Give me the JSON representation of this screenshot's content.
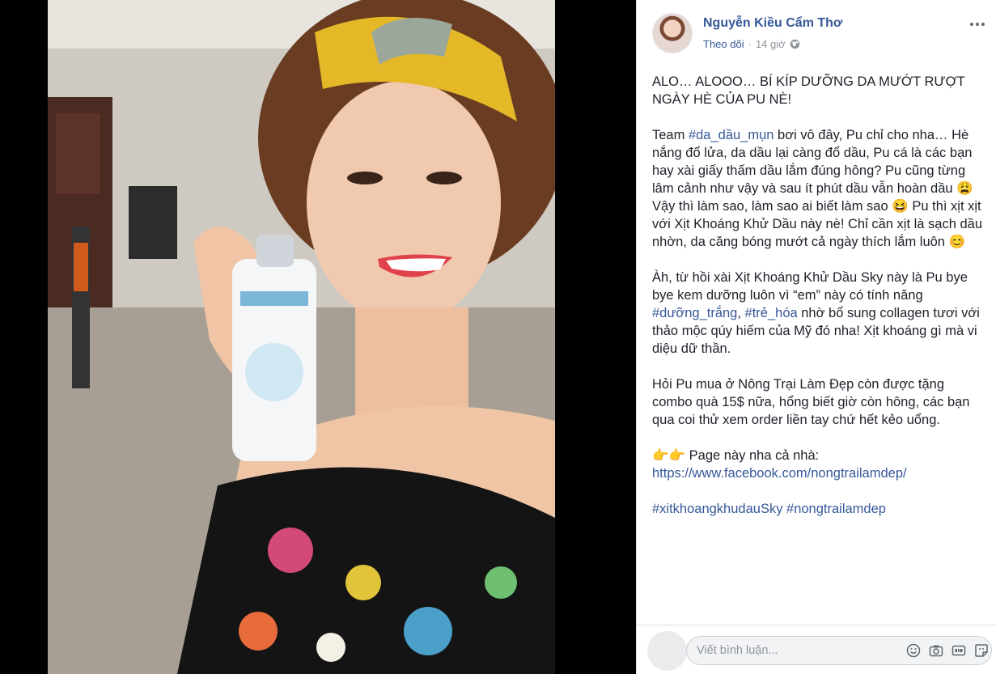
{
  "post": {
    "author": "Nguyễn Kiều Cẩm Thơ",
    "follow": "Theo dõi",
    "separator": "·",
    "time": "14 giờ",
    "paragraphs": {
      "p1": "ALO… ALOOO… BÍ KÍP DƯỠNG DA MƯỚT RƯỢT NGÀY HÈ CỦA PU NÈ!",
      "p2a": "Team ",
      "p2tag": "#da_dầu_mụn",
      "p2b": " bơi vô đây, Pu chỉ cho nha… Hè nắng đổ lửa, da dầu lại càng đổ dầu, Pu cá là các bạn hay xài giấy thấm dầu lắm đúng hông? Pu cũng từng lâm cảnh như vậy và sau ít phút dầu vẫn hoàn dầu 😩 Vậy thì làm sao, làm sao ai biết làm sao 😆 Pu thì xịt xịt với Xịt Khoáng Khử Dầu này nè! Chỉ cần xịt là sạch dầu nhờn, da căng bóng mướt cả ngày thích lắm luôn 😊",
      "p3a": "Àh, từ hồi xài Xịt Khoáng Khử Dầu Sky này là Pu bye bye kem dưỡng luôn vì “em” này có tính năng ",
      "p3tag1": "#dưỡng_trắng",
      "p3sep": ", ",
      "p3tag2": "#trẻ_hóa",
      "p3b": " nhờ bổ sung collagen tươi với thảo mộc qúy hiếm của Mỹ đó nha! Xịt khoáng gì mà vi diệu dữ thần.",
      "p4": "Hỏi Pu mua ở Nông Trại Làm Đẹp còn được tặng combo quà 15$ nữa, hổng biết giờ còn hông, các bạn qua coi thử xem order liền tay chứ hết kẻo uổng.",
      "p5a": "👉👉 Page này nha cả nhà:",
      "p5link": "https://www.facebook.com/nongtrailamdep/",
      "p6": "#xitkhoangkhudauSky #nongtrailamdep"
    }
  },
  "comment": {
    "placeholder": "Viết bình luận..."
  },
  "icons": {
    "globe": "globe-icon",
    "more": "more-options-icon",
    "emoji": "emoji-icon",
    "camera": "camera-icon",
    "gif": "gif-icon",
    "sticker": "sticker-icon"
  },
  "colors": {
    "link": "#365899",
    "text": "#1d2129",
    "meta": "#90949c"
  }
}
